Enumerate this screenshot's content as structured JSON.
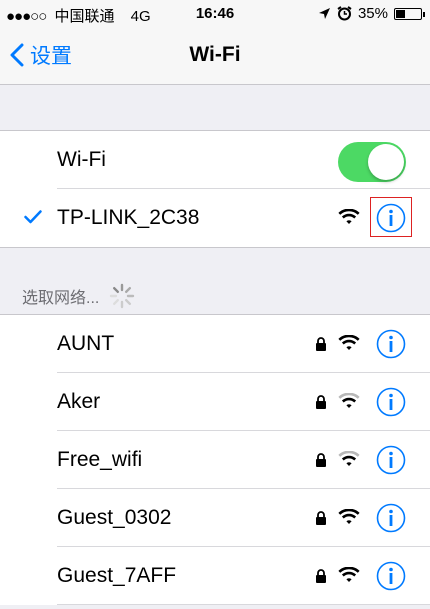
{
  "status_bar": {
    "signal_dots": "●●●○○",
    "carrier": "中国联通",
    "network": "4G",
    "time": "16:46",
    "battery": "35%",
    "battery_level": 0.35
  },
  "nav": {
    "back_label": "设置",
    "title": "Wi-Fi"
  },
  "wifi_toggle": {
    "label": "Wi-Fi",
    "on": true
  },
  "connected": {
    "name": "TP-LINK_2C38"
  },
  "section_header": "选取网络...",
  "networks": [
    {
      "name": "AUNT",
      "locked": true,
      "signal": "full"
    },
    {
      "name": "Aker",
      "locked": true,
      "signal": "medium"
    },
    {
      "name": "Free_wifi",
      "locked": true,
      "signal": "medium"
    },
    {
      "name": "Guest_0302",
      "locked": true,
      "signal": "full"
    },
    {
      "name": "Guest_7AFF",
      "locked": true,
      "signal": "full"
    }
  ],
  "colors": {
    "accent": "#007aff",
    "toggle_on": "#4cd964",
    "highlight": "#dd2222"
  }
}
